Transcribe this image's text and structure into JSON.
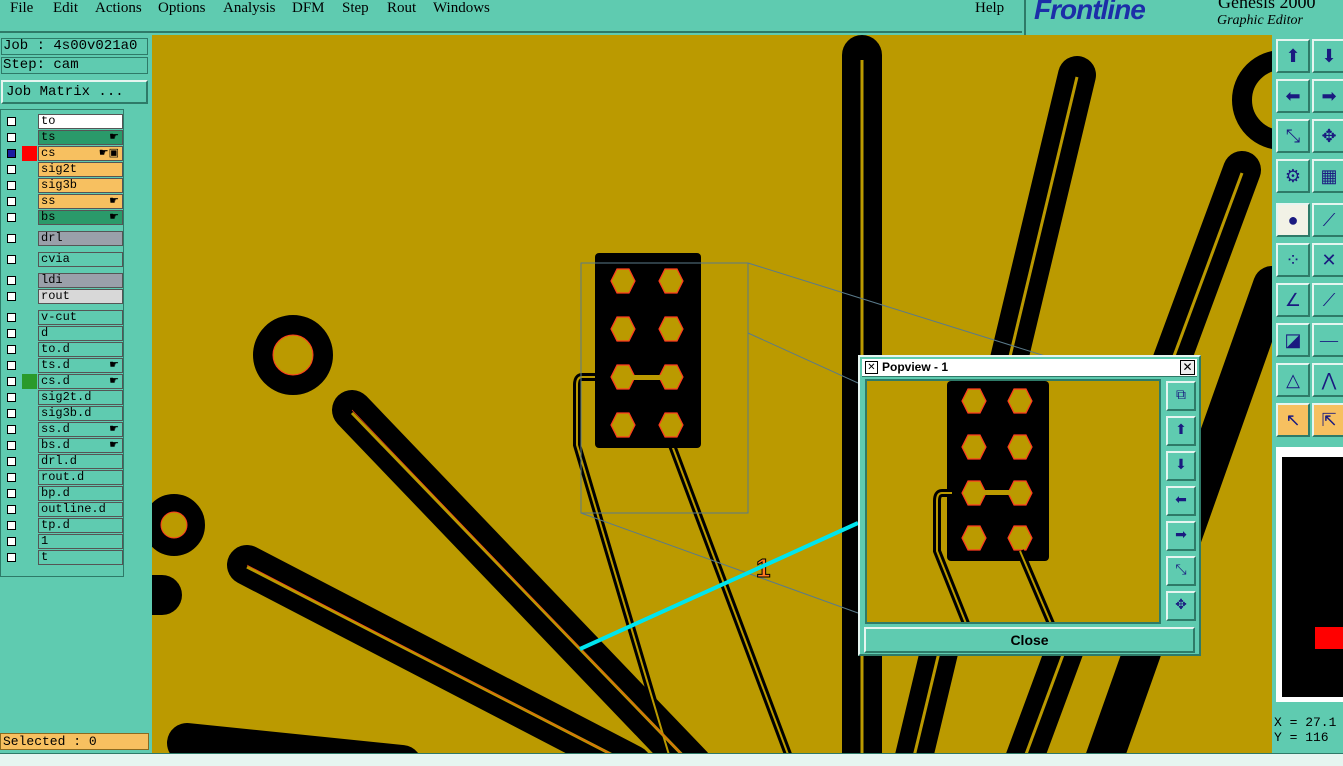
{
  "menubar": {
    "items": [
      {
        "label": "File",
        "mn": "F"
      },
      {
        "label": "Edit",
        "mn": "E"
      },
      {
        "label": "Actions",
        "mn": "A"
      },
      {
        "label": "Options",
        "mn": "O"
      },
      {
        "label": "Analysis",
        "mn": "A"
      },
      {
        "label": "DFM",
        "mn": "D"
      },
      {
        "label": "Step",
        "mn": "S"
      },
      {
        "label": "Rout",
        "mn": "R"
      },
      {
        "label": "Windows",
        "mn": "W"
      },
      {
        "label": "Help",
        "mn": "H"
      }
    ]
  },
  "brand": {
    "logo": "Frontline",
    "product": "Genesis 2000",
    "subtitle": "Graphic Editor"
  },
  "job": {
    "label": "Job : 4s00v021a0",
    "step": "Step: cam"
  },
  "job_matrix_button": "Job Matrix ...",
  "layers": [
    {
      "name": "to",
      "color": "#ffffff",
      "swatch": "",
      "mark": ""
    },
    {
      "name": "ts",
      "color": "#2a9a6a",
      "swatch": "",
      "mark": "☛"
    },
    {
      "name": "cs",
      "color": "#f7c060",
      "swatch": "#ff0000",
      "mark": "☛▣",
      "active": true
    },
    {
      "name": "sig2t",
      "color": "#f7c060",
      "swatch": "",
      "mark": ""
    },
    {
      "name": "sig3b",
      "color": "#f7c060",
      "swatch": "",
      "mark": ""
    },
    {
      "name": "ss",
      "color": "#f7c060",
      "swatch": "",
      "mark": "☛"
    },
    {
      "name": "bs",
      "color": "#2a9a6a",
      "swatch": "",
      "mark": "☛"
    },
    {
      "name": "drl",
      "color": "#9aa0aa",
      "swatch": "",
      "mark": ""
    },
    {
      "name": "cvia",
      "color": "#5fcbb0",
      "swatch": "",
      "mark": ""
    },
    {
      "name": "ldi",
      "color": "#9aa0aa",
      "swatch": "",
      "mark": ""
    },
    {
      "name": "rout",
      "color": "#d8d8d8",
      "swatch": "",
      "mark": ""
    },
    {
      "name": "v-cut",
      "color": "#5fcbb0",
      "swatch": "",
      "mark": ""
    },
    {
      "name": "d",
      "color": "#5fcbb0",
      "swatch": "",
      "mark": ""
    },
    {
      "name": "to.d",
      "color": "#5fcbb0",
      "swatch": "",
      "mark": ""
    },
    {
      "name": "ts.d",
      "color": "#5fcbb0",
      "swatch": "",
      "mark": "☛"
    },
    {
      "name": "cs.d",
      "color": "#5fcbb0",
      "swatch": "#2a9a2a",
      "mark": "☛"
    },
    {
      "name": "sig2t.d",
      "color": "#5fcbb0",
      "swatch": "",
      "mark": ""
    },
    {
      "name": "sig3b.d",
      "color": "#5fcbb0",
      "swatch": "",
      "mark": ""
    },
    {
      "name": "ss.d",
      "color": "#5fcbb0",
      "swatch": "",
      "mark": "☛"
    },
    {
      "name": "bs.d",
      "color": "#5fcbb0",
      "swatch": "",
      "mark": "☛"
    },
    {
      "name": "drl.d",
      "color": "#5fcbb0",
      "swatch": "",
      "mark": ""
    },
    {
      "name": "rout.d",
      "color": "#5fcbb0",
      "swatch": "",
      "mark": ""
    },
    {
      "name": "bp.d",
      "color": "#5fcbb0",
      "swatch": "",
      "mark": ""
    },
    {
      "name": "outline.d",
      "color": "#5fcbb0",
      "swatch": "",
      "mark": ""
    },
    {
      "name": "tp.d",
      "color": "#5fcbb0",
      "swatch": "",
      "mark": ""
    },
    {
      "name": "1",
      "color": "#5fcbb0",
      "swatch": "",
      "mark": ""
    },
    {
      "name": "t",
      "color": "#5fcbb0",
      "swatch": "",
      "mark": ""
    }
  ],
  "selected": "Selected : 0",
  "popview": {
    "title": "Popview - 1",
    "close": "Close"
  },
  "coords": {
    "x": "X = 27.1",
    "y": "Y = 116"
  },
  "colors": {
    "board": "#bb9a00",
    "copper": "#000000",
    "outline": "#ff3b1f",
    "pointer": "#00e5ee",
    "panel": "#5fcbb0"
  }
}
